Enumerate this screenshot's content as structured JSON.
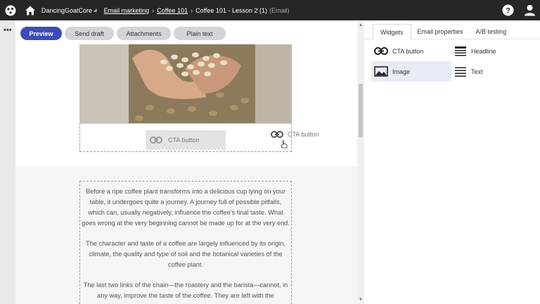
{
  "header": {
    "site_name": "DancingGoatCore",
    "breadcrumb": [
      "Email marketing",
      "Coffee 101"
    ],
    "current_item": "Coffee 101 - Lesson 2 (1)",
    "item_type": "(Email)",
    "icons": [
      "app-logo-icon",
      "home-icon",
      "help-icon",
      "user-icon"
    ]
  },
  "toolbar": {
    "preview_label": "Preview",
    "send_draft_label": "Send draft",
    "attachments_label": "Attachments",
    "plain_text_label": "Plain text"
  },
  "editor": {
    "cta_placeholder_label": "CTA button",
    "drag_ghost_label": "CTA button",
    "paragraphs": [
      "Before a ripe coffee plant transforms into a delicious cup lying on your table, it undergoes quite a journey. A journey full of possible pitfalls, which can, usually negatively, influence the coffee’s final taste. What goes wrong at the very beginning cannot be made up for at the very end.",
      "The character and taste of a coffee are largely influenced by its origin, climate, the quality and type of soil and the botanical varieties of the coffee plant.",
      "The last two links of the chain—the roastery and the barista—cannot, in any way, improve the taste of the coffee. They are left with the"
    ]
  },
  "panel": {
    "tabs": [
      "Widgets",
      "Email properties",
      "A/B testing"
    ],
    "active_tab": "Widgets",
    "widgets": [
      {
        "label": "CTA button",
        "icon": "link-icon"
      },
      {
        "label": "Headline",
        "icon": "headline-icon"
      },
      {
        "label": "Image",
        "icon": "image-icon"
      },
      {
        "label": "Text",
        "icon": "text-icon"
      }
    ],
    "selected_widget": "Image"
  },
  "colors": {
    "topbar": "#262626",
    "accent": "#3a4db7",
    "pill": "#d4d4d8",
    "selected_widget_bg": "#e8ecf6"
  }
}
